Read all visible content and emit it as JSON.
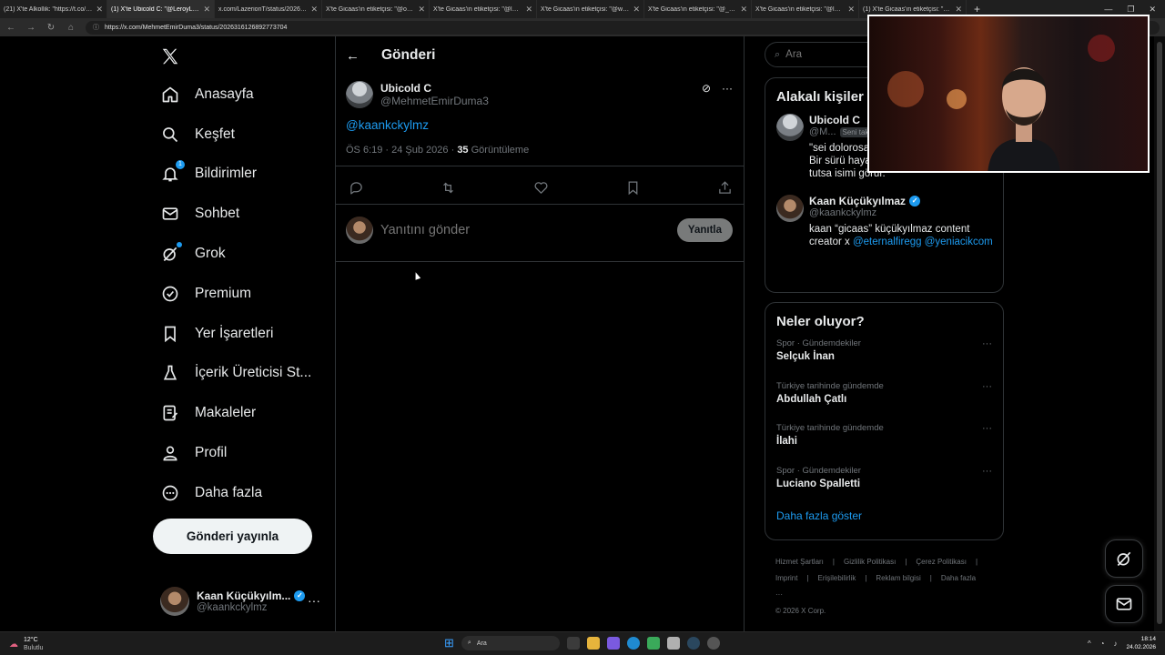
{
  "browser": {
    "tabs": [
      {
        "label": "(21) X'te Alkollik: \"https://t.co/Wh",
        "active": false
      },
      {
        "label": "(1) X'te Ubicold C: \"@LeroyLegacy",
        "active": true
      },
      {
        "label": "x.com/LazerionT/status/20263163",
        "active": false
      },
      {
        "label": "X'te Gicaas'ın etiketçisi: \"@osimhe",
        "active": false
      },
      {
        "label": "X'te Gicaas'ın etiketçisi: \"@lamela",
        "active": false
      },
      {
        "label": "X'te Gicaas'ın etiketçisi: \"@winne",
        "active": false
      },
      {
        "label": "X'te Gicaas'ın etiketçisi: \"@_LucaTi",
        "active": false
      },
      {
        "label": "X'te Gicaas'ın etiketçisi: \"@lemanc",
        "active": false
      },
      {
        "label": "(1) X'te Gicaas'ın etiketçisi: \"@Eski",
        "active": false
      }
    ],
    "new_tab": "+",
    "url": "https://x.com/MehmetEmirDuma3/status/2026316126892773704"
  },
  "nav": {
    "items": [
      {
        "label": "Anasayfa",
        "icon": "home-icon"
      },
      {
        "label": "Keşfet",
        "icon": "search-icon"
      },
      {
        "label": "Bildirimler",
        "icon": "bell-icon",
        "badge": "1"
      },
      {
        "label": "Sohbet",
        "icon": "mail-icon"
      },
      {
        "label": "Grok",
        "icon": "grok-icon"
      },
      {
        "label": "Premium",
        "icon": "premium-icon"
      },
      {
        "label": "Yer İşaretleri",
        "icon": "bookmark-icon"
      },
      {
        "label": "İçerik Üreticisi St...",
        "icon": "creator-studio-icon"
      },
      {
        "label": "Makaleler",
        "icon": "articles-icon"
      },
      {
        "label": "Profil",
        "icon": "profile-icon"
      },
      {
        "label": "Daha fazla",
        "icon": "more-circle-icon"
      }
    ],
    "post_button": "Gönderi yayınla",
    "account": {
      "name": "Kaan Küçükyılm...",
      "handle": "@kaankckylmz"
    }
  },
  "post": {
    "header_title": "Gönderi",
    "author_name": "Ubicold C",
    "author_handle": "@MehmetEmirDuma3",
    "text": "@kaankckylmz",
    "time": "ÖS 6:19 · 24 Şub 2026 · ",
    "views_count": "35",
    "views_label": " Görüntüleme",
    "reply_placeholder": "Yanıtını gönder",
    "reply_button": "Yanıtla"
  },
  "sidebar": {
    "search_placeholder": "Ara",
    "related_title": "Alakalı kişiler",
    "related": [
      {
        "name": "Ubicold C",
        "handle": "@M...",
        "follows_you": "Seni takip ediyor",
        "bio": "\"sei dolorosa ... verecek kadar güzelsin\" Bir sürü hayal kuruyorum, bir tanesi bile tutsa isimi görür.\"",
        "verified": false
      },
      {
        "name": "Kaan Küçükyılmaz",
        "handle": "@kaankckylmz",
        "bio_prefix": "kaan “gicaas” küçükyılmaz content creator x ",
        "bio_link1": "@eternalfiregg",
        "bio_link2": " @yeniacikcom",
        "verified": true
      }
    ],
    "trends_title": "Neler oluyor?",
    "trends": [
      {
        "category": "Spor · Gündemdekiler",
        "title": "Selçuk İnan"
      },
      {
        "category": "Türkiye tarihinde gündemde",
        "title": "Abdullah Çatlı"
      },
      {
        "category": "Türkiye tarihinde gündemde",
        "title": "İlahi"
      },
      {
        "category": "Spor · Gündemdekiler",
        "title": "Luciano Spalletti"
      }
    ],
    "show_more": "Daha fazla göster",
    "footer": [
      "Hizmet Şartları",
      "|",
      "Gizlilik Politikası",
      "|",
      "Çerez Politikası",
      "|",
      "Imprint",
      "|",
      "Erişilebilirlik",
      "|",
      "Reklam bilgisi",
      "|",
      "Daha fazla ···",
      "© 2026 X Corp."
    ]
  },
  "taskbar": {
    "weather_temp": "12°C",
    "weather_desc": "Bulutlu",
    "search": "Ara",
    "time": "18:14",
    "date": "24.02.2026"
  },
  "colors": {
    "accent": "#1d9bf0",
    "text": "#e7e9ea",
    "muted": "#71767b",
    "border": "#2f3336"
  }
}
